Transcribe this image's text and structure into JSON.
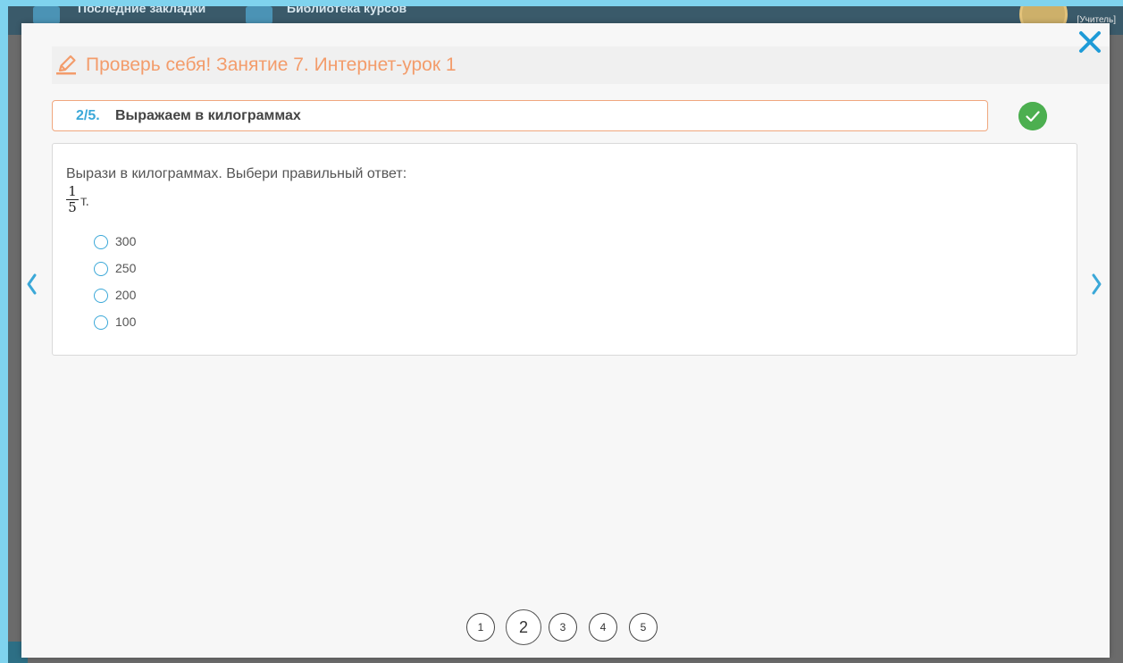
{
  "background": {
    "topbar_left_label": "Последние закладки",
    "topbar_right_label": "Библиотека курсов",
    "user_role": "[Учитель]"
  },
  "modal": {
    "title": "Проверь себя! Занятие 7. Интернет-урок 1",
    "close_icon": "close-icon",
    "question": {
      "number": "2/5.",
      "title": "Выражаем в килограммах",
      "status": "answered-correct",
      "prompt": "Вырази в килограммах. Выбери правильный ответ:",
      "fraction_numerator": "1",
      "fraction_denominator": "5",
      "unit": "т.",
      "options": [
        {
          "label": "300",
          "selected": false
        },
        {
          "label": "250",
          "selected": false
        },
        {
          "label": "200",
          "selected": false
        },
        {
          "label": "100",
          "selected": false
        }
      ]
    },
    "pagination": {
      "pages": [
        "1",
        "2",
        "3",
        "4",
        "5"
      ],
      "current": "2"
    },
    "nav": {
      "prev_icon": "chevron-left-icon",
      "next_icon": "chevron-right-icon"
    }
  },
  "colors": {
    "accent_orange": "#f39c6b",
    "accent_blue": "#3ba8d8",
    "success_green": "#4caf50"
  }
}
